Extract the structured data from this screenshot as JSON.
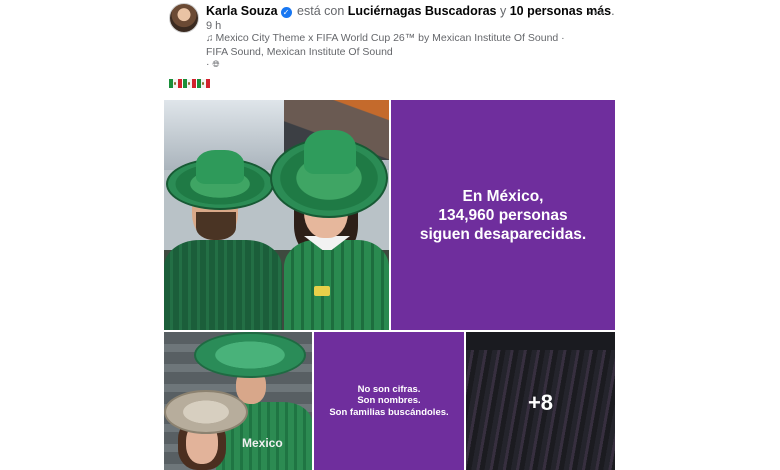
{
  "post": {
    "author": "Karla Souza",
    "with_label": "está con",
    "tagged_page": "Luciérnagas Buscadoras",
    "and_label": "y",
    "others": "10 personas más",
    "period": ".",
    "time": "9 h",
    "music_line": "Mexico City Theme x FIFA World Cup 26™ by Mexican Institute Of Sound · FIFA Sound, Mexican Institute Of Sound",
    "music_tail": "·",
    "more_menu_label": "···"
  },
  "caption": {
    "flag_count": 3
  },
  "media": {
    "main_tile_text": "En México,\n134,960 personas\nsiguen desaparecidas.",
    "mid_tile_text": "No son cifras.\nSon nombres.\nSon familias buscándoles.",
    "stadium_jersey_word": "Mexico",
    "more_count": "+8"
  },
  "colors": {
    "accent_purple": "#6f2e9d",
    "link_blue": "#1877f2"
  },
  "icons": [
    "verified-badge-icon",
    "music-note-icon",
    "globe-icon",
    "more-options-icon",
    "mexico-flag-icon"
  ]
}
